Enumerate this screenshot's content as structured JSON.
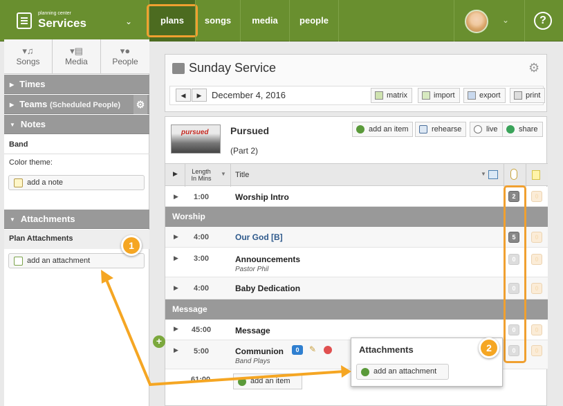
{
  "header": {
    "brand_small": "planning center",
    "brand_name": "Services",
    "nav": [
      "plans",
      "songs",
      "media",
      "people"
    ],
    "help": "?"
  },
  "sidebar": {
    "tabs": [
      {
        "label": "Songs",
        "icon": "music-note-icon"
      },
      {
        "label": "Media",
        "icon": "film-icon"
      },
      {
        "label": "People",
        "icon": "person-icon"
      }
    ],
    "sections": {
      "times": "Times",
      "teams": "Teams",
      "teams_sub": "(Scheduled People)",
      "notes": "Notes",
      "attachments": "Attachments"
    },
    "band": "Band",
    "color_theme": "Color theme:",
    "add_note": "add a note",
    "plan_attachments": "Plan Attachments",
    "add_attachment": "add an attachment"
  },
  "plan": {
    "title": "Sunday Service",
    "date": "December 4, 2016",
    "toolbar": [
      "matrix",
      "import",
      "export",
      "print"
    ]
  },
  "item": {
    "thumb_text": "pursued",
    "title": "Pursued",
    "subtitle": "(Part 2)",
    "actions": [
      "add an item",
      "rehearse",
      "live",
      "share"
    ]
  },
  "columns": {
    "length": "Length",
    "length2": "In Mins",
    "title": "Title"
  },
  "rows": {
    "r1": {
      "length": "1:00",
      "title": "Worship Intro",
      "att": "2",
      "note": "0"
    },
    "sect1": "Worship",
    "r2": {
      "length": "4:00",
      "title": "Our God [B]",
      "att": "5",
      "note": "0"
    },
    "r3": {
      "length": "3:00",
      "title": "Announcements",
      "sub": "Pastor Phil",
      "att": "0",
      "note": "0"
    },
    "r4": {
      "length": "4:00",
      "title": "Baby Dedication",
      "att": "0",
      "note": "0"
    },
    "sect2": "Message",
    "r5": {
      "length": "45:00",
      "title": "Message",
      "att": "0",
      "note": "0"
    },
    "r6": {
      "length": "5:00",
      "title": "Communion",
      "sub": "Band Plays",
      "comment": "0",
      "att": "0",
      "note": "0"
    }
  },
  "popover": {
    "title": "Attachments",
    "button": "add an attachment"
  },
  "bottom": {
    "length": "61:00",
    "add_item": "add an item"
  },
  "callouts": [
    "1",
    "2"
  ],
  "colors": {
    "brand_green": "#698f2f",
    "callout_orange": "#f5a623",
    "section_gray": "#999999"
  }
}
